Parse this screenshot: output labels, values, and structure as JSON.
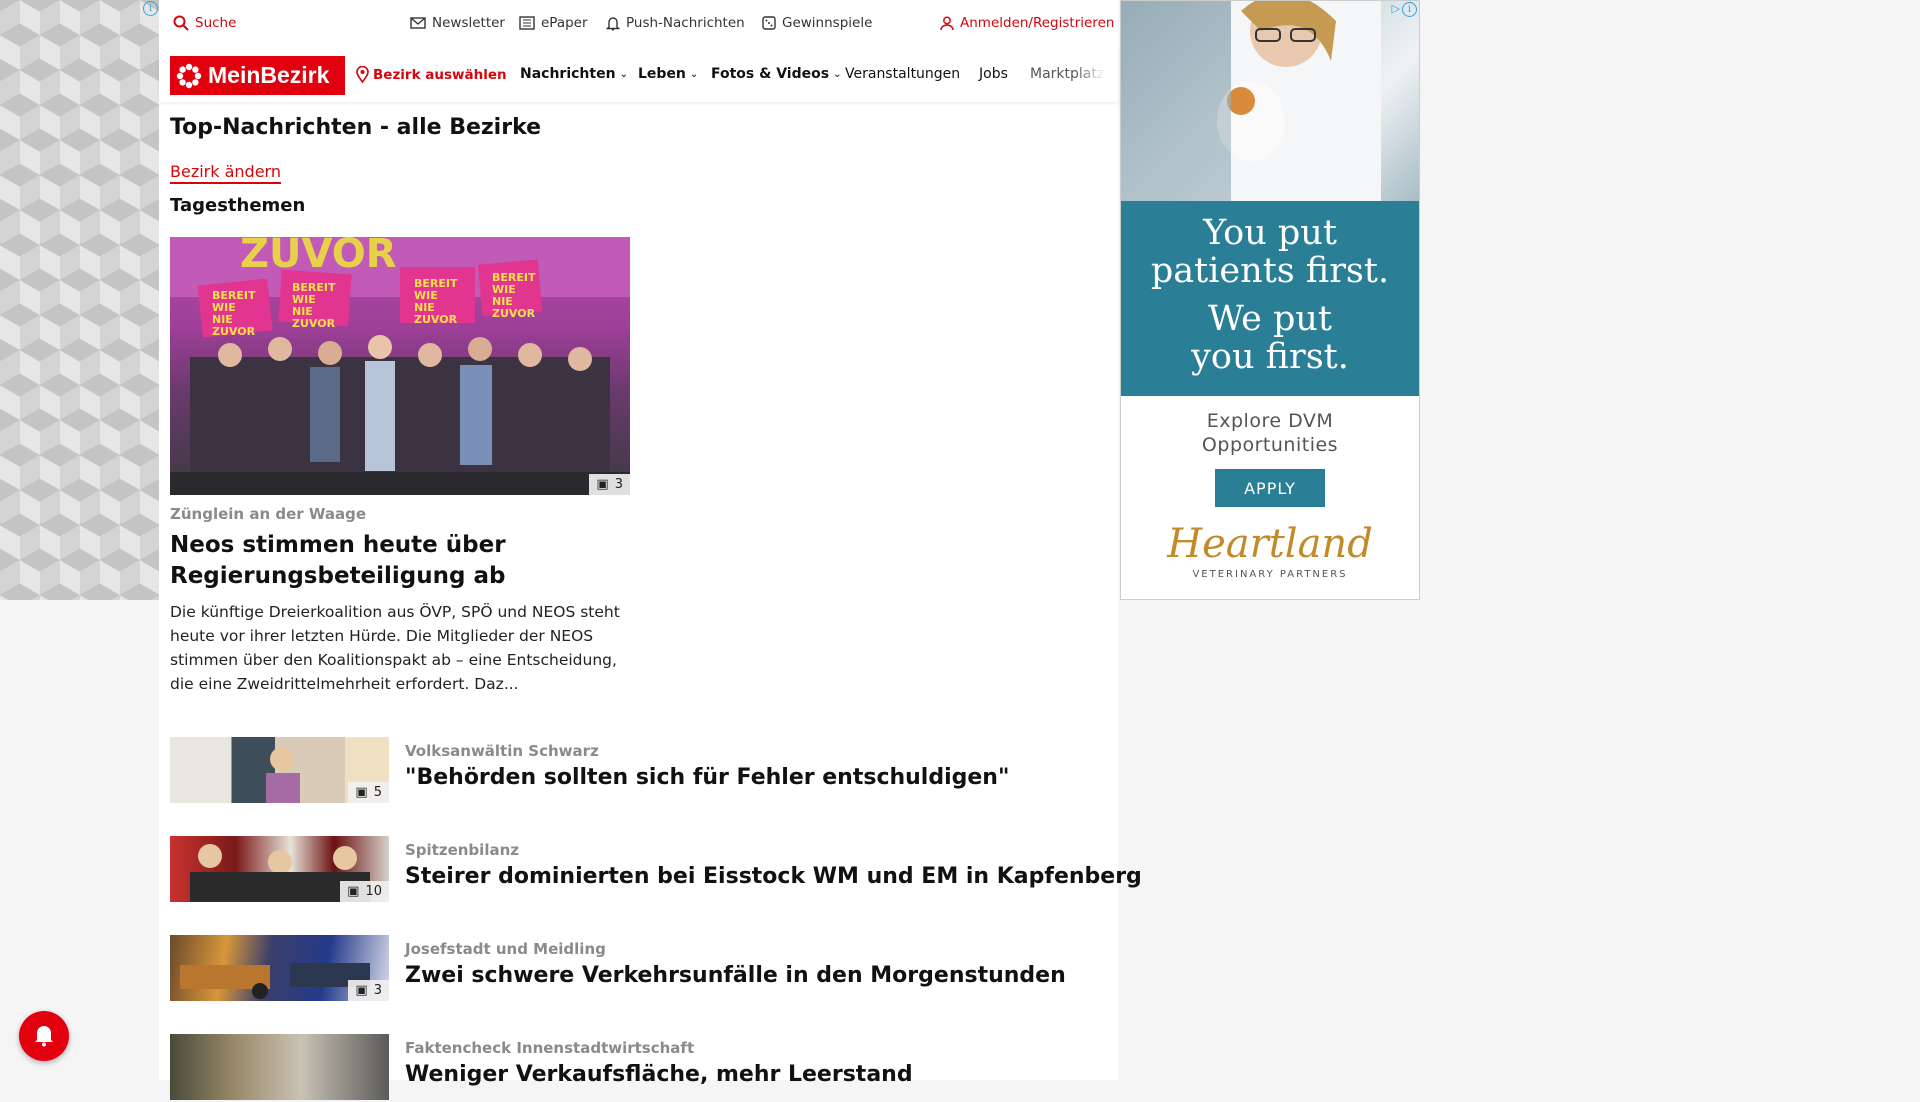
{
  "topbar": {
    "search_label": "Suche",
    "newsletter_label": "Newsletter",
    "epaper_label": "ePaper",
    "push_label": "Push-Nachrichten",
    "gewinnspiele_label": "Gewinnspiele",
    "login_label": "Anmelden/Registrieren"
  },
  "nav": {
    "logo_text": "MeinBezirk",
    "bezirk_label": "Bezirk auswählen",
    "items": [
      {
        "label": "Nachrichten"
      },
      {
        "label": "Leben"
      },
      {
        "label": "Fotos & Videos"
      },
      {
        "label": "Veranstaltungen"
      },
      {
        "label": "Jobs"
      },
      {
        "label": "Marktplatz"
      }
    ]
  },
  "page": {
    "title": "Top-Nachrichten - alle Bezirke",
    "change_bezirk": "Bezirk ändern",
    "section_title": "Tagesthemen"
  },
  "lead": {
    "kicker": "Zünglein an der Waage",
    "title": "Neos stimmen heute über Regierungsbeteiligung ab",
    "text": "Die künftige Dreierkoalition aus ÖVP, SPÖ und NEOS steht heute vor ihrer letzten Hürde. Die Mitglieder der NEOS stimmen über den Koalitionspakt ab – eine Entscheidung, die eine Zweidrittelmehrheit erfordert. Daz...",
    "image_count": "3",
    "image_signs": [
      "BEREIT WIE NIE ZUVOR",
      "ZUVOR"
    ]
  },
  "articles": [
    {
      "kicker": "Volksanwältin Schwarz",
      "title": "\"Behörden sollten sich für Fehler entschuldigen\"",
      "count": "5"
    },
    {
      "kicker": "Spitzenbilanz",
      "title": "Steirer dominierten bei Eisstock WM und EM in Kapfenberg",
      "count": "10"
    },
    {
      "kicker": "Josefstadt und Meidling",
      "title": "Zwei schwere Verkehrsunfälle in den Morgenstunden",
      "count": "3"
    },
    {
      "kicker": "Faktencheck Innenstadtwirtschaft",
      "title": "Weniger Verkaufsfläche, mehr Leerstand",
      "count": ""
    }
  ],
  "ad": {
    "headline_lines": [
      "You put",
      "patients first.",
      "We put",
      "you first."
    ],
    "explore_lines": [
      "Explore DVM",
      "Opportunities"
    ],
    "apply_label": "APPLY",
    "brand": "Heartland",
    "brand_sub": "VETERINARY PARTNERS"
  },
  "colors": {
    "brand_red": "#e2000f",
    "link_red": "#d4060d",
    "ad_teal": "#2a7f96",
    "ad_gold": "#c28b2a"
  }
}
